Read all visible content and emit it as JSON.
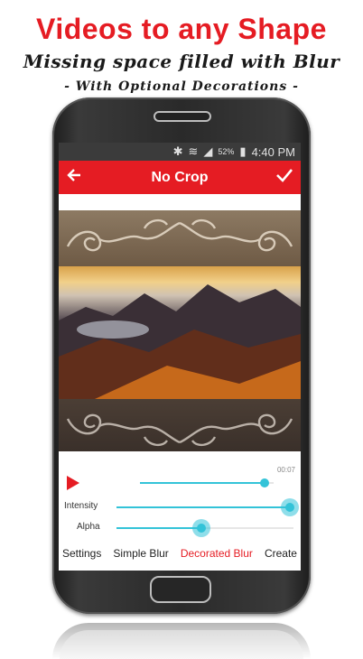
{
  "promo": {
    "title": "Videos to any Shape",
    "subtitle": "Missing space filled with Blur",
    "tagline": "- With Optional Decorations -"
  },
  "status_bar": {
    "battery": "52%",
    "time": "4:40 PM"
  },
  "app_bar": {
    "title": "No Crop",
    "back_icon": "arrow-left-icon",
    "confirm_icon": "checkmark-icon"
  },
  "player": {
    "elapsed": "00:07",
    "progress": 0.93
  },
  "sliders": {
    "intensity": {
      "label": "Intensity",
      "value": 0.98
    },
    "alpha": {
      "label": "Alpha",
      "value": 0.48
    }
  },
  "tabs": [
    {
      "label": "Settings",
      "active": false
    },
    {
      "label": "Simple Blur",
      "active": false
    },
    {
      "label": "Decorated Blur",
      "active": true
    },
    {
      "label": "Create",
      "active": false
    }
  ],
  "colors": {
    "accent": "#e51c23",
    "slider": "#33c3d8"
  }
}
